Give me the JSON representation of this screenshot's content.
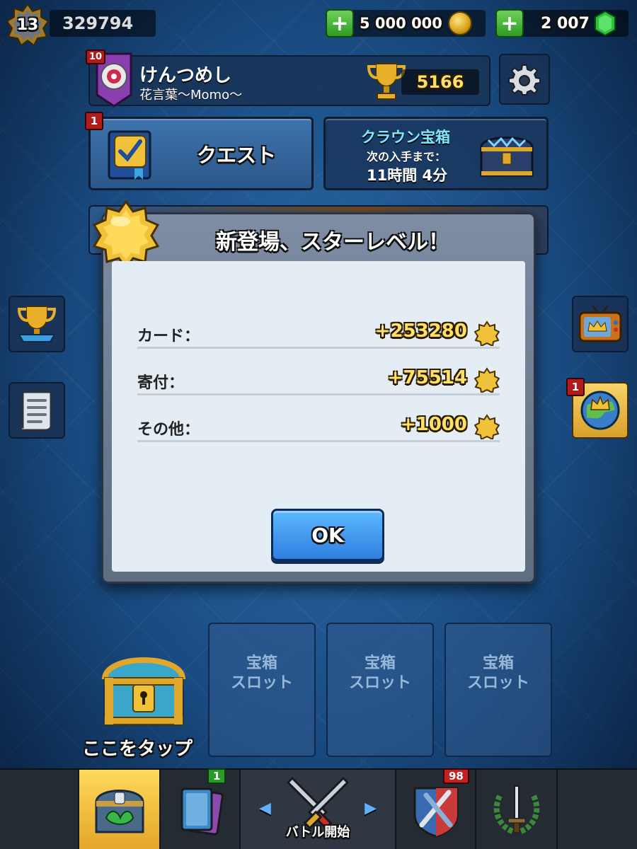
{
  "header": {
    "level": "13",
    "experience": "329794",
    "gold": "5 000 000",
    "gems": "2 007"
  },
  "profile": {
    "clan_level": "10",
    "player_name": "けんつめし",
    "clan_name": "花言葉〜Momo〜",
    "trophies": "5166"
  },
  "quest": {
    "badge": "1",
    "label": "クエスト"
  },
  "crown_chest": {
    "title": "クラウン宝箱",
    "subtitle": "次の入手まで：",
    "time": "11時間 4分"
  },
  "side": {
    "news_badge": "1"
  },
  "modal": {
    "title": "新登場、スターレベル！",
    "rows": [
      {
        "label": "カード：",
        "value": "+253280"
      },
      {
        "label": "寄付：",
        "value": "+75514"
      },
      {
        "label": "その他：",
        "value": "+1000"
      }
    ],
    "ok_label": "OK"
  },
  "chest_slots": {
    "tap_label": "ここをタップ",
    "slots": [
      {
        "line1": "宝箱",
        "line2": "スロット"
      },
      {
        "line1": "宝箱",
        "line2": "スロット"
      },
      {
        "line1": "宝箱",
        "line2": "スロット"
      }
    ]
  },
  "nav": {
    "cards_badge": "1",
    "battle_label": "バトル開始",
    "clan_badge": "98"
  }
}
